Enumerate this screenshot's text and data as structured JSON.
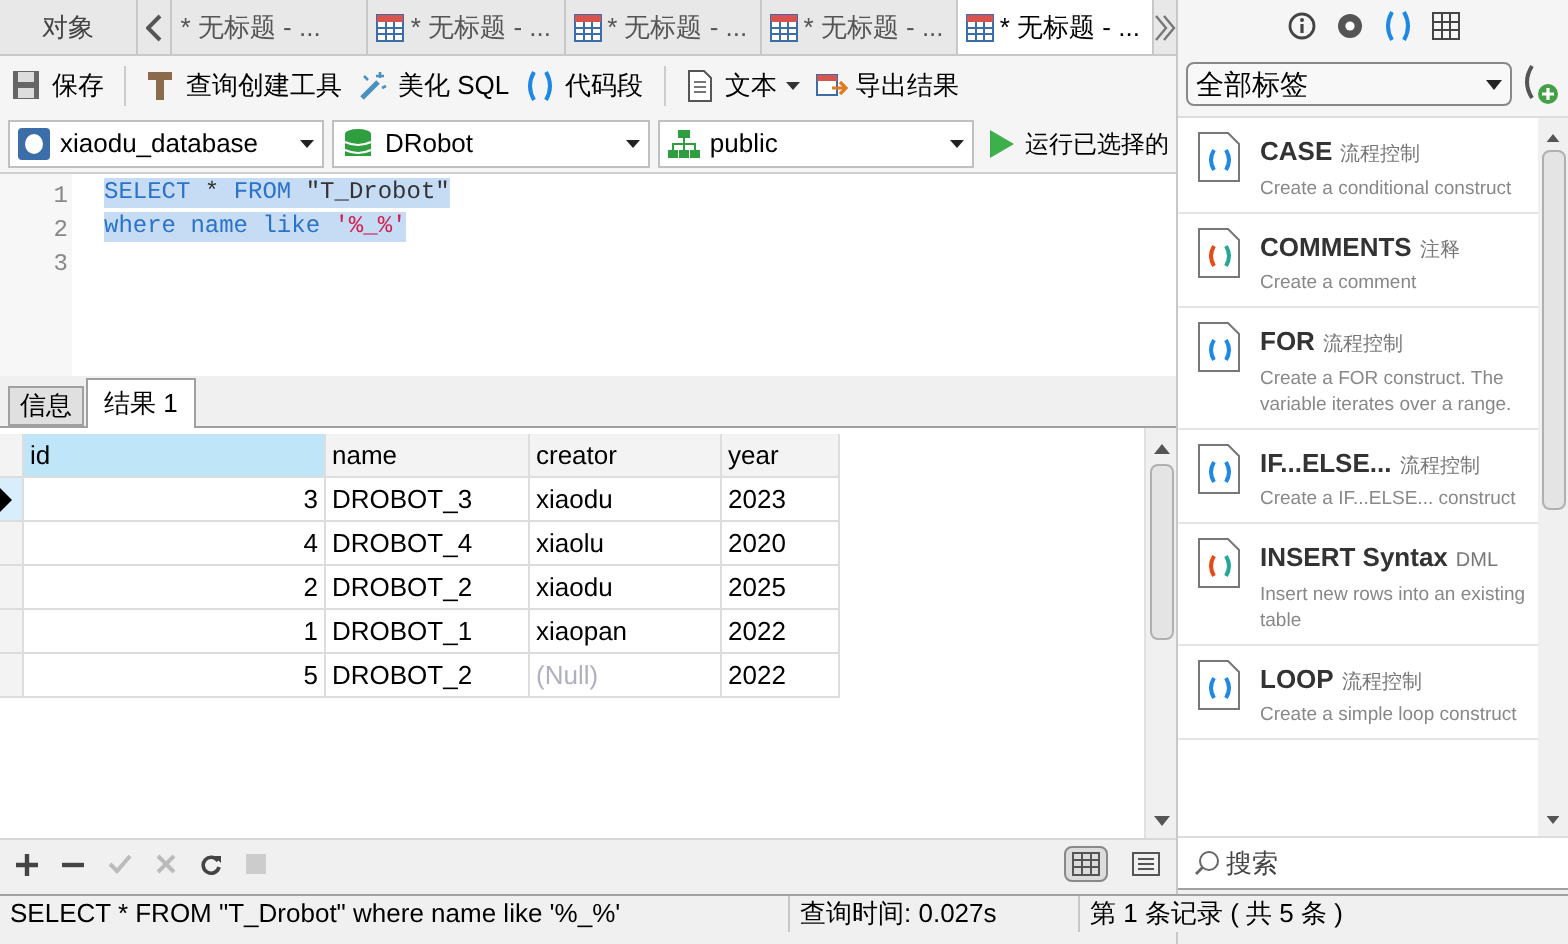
{
  "tabs": [
    {
      "label": "对象",
      "kind": "plain",
      "selected": false
    },
    {
      "label": "* 无标题 - ...",
      "kind": "query",
      "selected": false
    },
    {
      "label": "* 无标题 - ...",
      "kind": "query",
      "selected": false
    },
    {
      "label": "* 无标题 - ...",
      "kind": "query",
      "selected": false
    },
    {
      "label": "* 无标题 - ...",
      "kind": "query",
      "selected": false
    },
    {
      "label": "* 无标题 - ...",
      "kind": "query",
      "selected": true
    }
  ],
  "toolbar": [
    {
      "label": "保存",
      "kind": "save"
    },
    {
      "label": "查询创建工具",
      "kind": "builder"
    },
    {
      "label": "美化 SQL",
      "kind": "beautify"
    },
    {
      "label": "代码段",
      "kind": "snippet"
    },
    {
      "label": "文本",
      "kind": "text"
    },
    {
      "label": "导出结果",
      "kind": "export"
    }
  ],
  "selectors": [
    {
      "value": "xiaodu_database",
      "kind": "connection"
    },
    {
      "value": "DRobot",
      "kind": "database"
    },
    {
      "value": "public",
      "kind": "schema"
    }
  ],
  "run_button": "运行已选择的",
  "editor": {
    "lines": [
      {
        "number": "1",
        "tokens": [
          {
            "text": "SELECT",
            "kind": "keyword"
          },
          {
            "text": " * ",
            "kind": "plain"
          },
          {
            "text": "FROM",
            "kind": "keyword"
          },
          {
            "text": " \"T_Drobot\"",
            "kind": "plain"
          }
        ]
      },
      {
        "number": "2",
        "tokens": [
          {
            "text": "where name like ",
            "kind": "keyword"
          },
          {
            "text": "'%_%'",
            "kind": "string"
          }
        ]
      },
      {
        "number": "3"
      }
    ]
  },
  "result_tabs": [
    {
      "label": "信息",
      "selected": false
    },
    {
      "label": "结果 1",
      "selected": true
    }
  ],
  "table": {
    "columns": [
      "id",
      "name",
      "creator",
      "year"
    ],
    "rows": [
      {
        "cells": [
          "3",
          "DROBOT_3",
          "xiaodu",
          "2023"
        ],
        "selected": true
      },
      {
        "cells": [
          "4",
          "DROBOT_4",
          "xiaolu",
          "2020"
        ],
        "selected": false
      },
      {
        "cells": [
          "2",
          "DROBOT_2",
          "xiaodu",
          "2025"
        ],
        "selected": false
      },
      {
        "cells": [
          "1",
          "DROBOT_1",
          "xiaopan",
          "2022"
        ],
        "selected": false
      },
      {
        "cells": [
          "5",
          "DROBOT_2",
          "(Null)",
          "2022"
        ],
        "selected": false
      }
    ]
  },
  "status_bar": {
    "query": "SELECT * FROM \"T_Drobot\" where name like '%_%'",
    "time": "查询时间: 0.027s",
    "records": "第 1 条记录 ( 共 5 条 )"
  },
  "side_panel": {
    "tag_filter": "全部标签",
    "snippets": [
      {
        "title": "CASE",
        "tag": "流程控制",
        "description": "Create a conditional construct",
        "kind": "flow"
      },
      {
        "title": "COMMENTS",
        "tag": "注释",
        "description": "Create a comment",
        "kind": "multi"
      },
      {
        "title": "FOR",
        "tag": "流程控制",
        "description": "Create a FOR construct. The variable iterates over a range.",
        "kind": "flow"
      },
      {
        "title": "IF...ELSE...",
        "tag": "流程控制",
        "description": "Create a IF...ELSE... construct",
        "kind": "flow"
      },
      {
        "title": "INSERT Syntax",
        "tag": "DML",
        "description": "Insert new rows into an existing table",
        "kind": "multi"
      },
      {
        "title": "LOOP",
        "tag": "流程控制",
        "description": "Create a simple loop construct",
        "kind": "flow"
      }
    ],
    "search_placeholder": "搜索"
  }
}
